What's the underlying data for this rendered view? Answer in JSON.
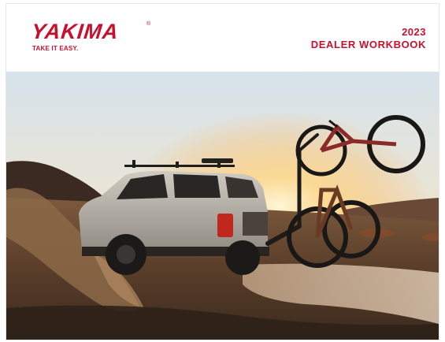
{
  "brand": {
    "name": "YAKIMA",
    "registered_mark": "®",
    "tagline": "TAKE IT EASY.",
    "color": "#c8102e"
  },
  "document": {
    "year": "2023",
    "title": "DEALER WORKBOOK"
  },
  "cover_photo": {
    "subject": "white SUV with roof rack and hitch bike rack carrying two bikes, driving through mud at sunset"
  }
}
